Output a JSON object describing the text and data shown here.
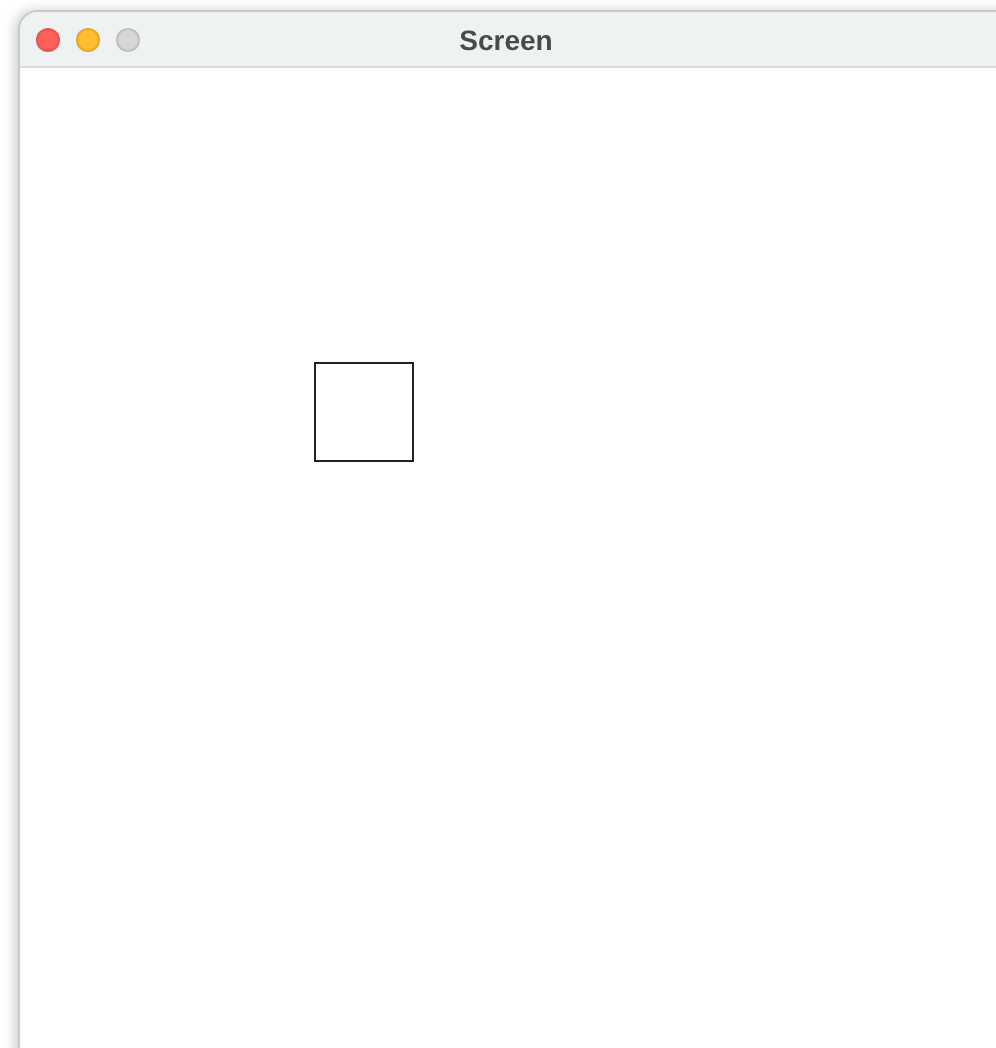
{
  "window": {
    "title": "Screen",
    "buttons": [
      {
        "kind": "close",
        "disabled": false
      },
      {
        "kind": "minimize",
        "disabled": false
      },
      {
        "kind": "zoom",
        "disabled": true
      }
    ]
  },
  "canvas": {
    "shapes": [
      {
        "kind": "square"
      }
    ]
  }
}
